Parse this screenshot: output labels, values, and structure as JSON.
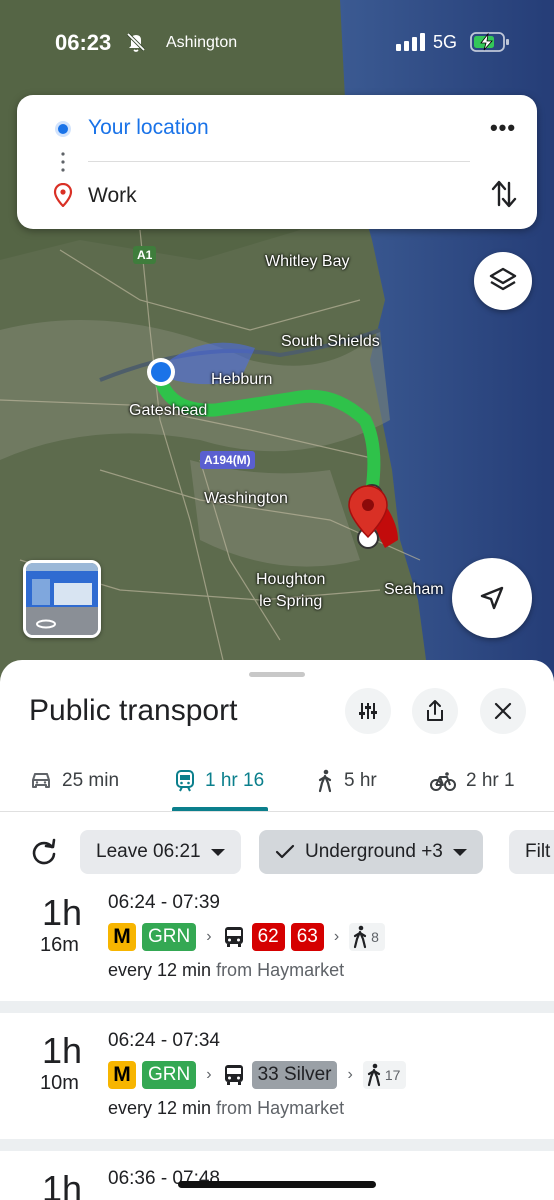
{
  "status": {
    "time": "06:23",
    "location": "Ashington",
    "network": "5G"
  },
  "route_card": {
    "from": "Your location",
    "to": "Work",
    "more": "•••"
  },
  "map_labels": {
    "whitley_bay": "Whitley Bay",
    "south_shields": "South Shields",
    "hebburn": "Hebburn",
    "gateshead": "Gateshead",
    "washington": "Washington",
    "houghton": "Houghton\nle Spring",
    "seaham": "Seaham",
    "a1": "A1",
    "a194m": "A194(M)"
  },
  "sheet": {
    "title": "Public transport",
    "modes": [
      {
        "icon": "car-icon",
        "label": "25 min"
      },
      {
        "icon": "train-icon",
        "label": "1 hr 16"
      },
      {
        "icon": "walk-icon",
        "label": "5 hr"
      },
      {
        "icon": "bike-icon",
        "label": "2 hr 1"
      }
    ],
    "filters": {
      "leave": "Leave 06:21",
      "underground": "Underground +3",
      "filter": "Filt"
    }
  },
  "routes": [
    {
      "dur_big": "1h",
      "dur_small": "16m",
      "times": "06:24 - 07:39",
      "metro": "M",
      "line": "GRN",
      "buses": [
        "62",
        "63"
      ],
      "walk": "8",
      "frequency": "every 12 min",
      "from": "from Haymarket"
    },
    {
      "dur_big": "1h",
      "dur_small": "10m",
      "times": "06:24 - 07:34",
      "metro": "M",
      "line": "GRN",
      "buses": [
        "33 Silver"
      ],
      "walk": "17",
      "frequency": "every 12 min",
      "from": "from Haymarket"
    },
    {
      "dur_big": "1h",
      "times": "06:36 - 07:48"
    }
  ],
  "colors": {
    "accent": "#0b7f8c",
    "metro_green": "#34a853",
    "bus_red": "#d50000",
    "bus_grey": "#9aa0a6",
    "route_green": "#2fc24a",
    "pin_red": "#d93025"
  }
}
